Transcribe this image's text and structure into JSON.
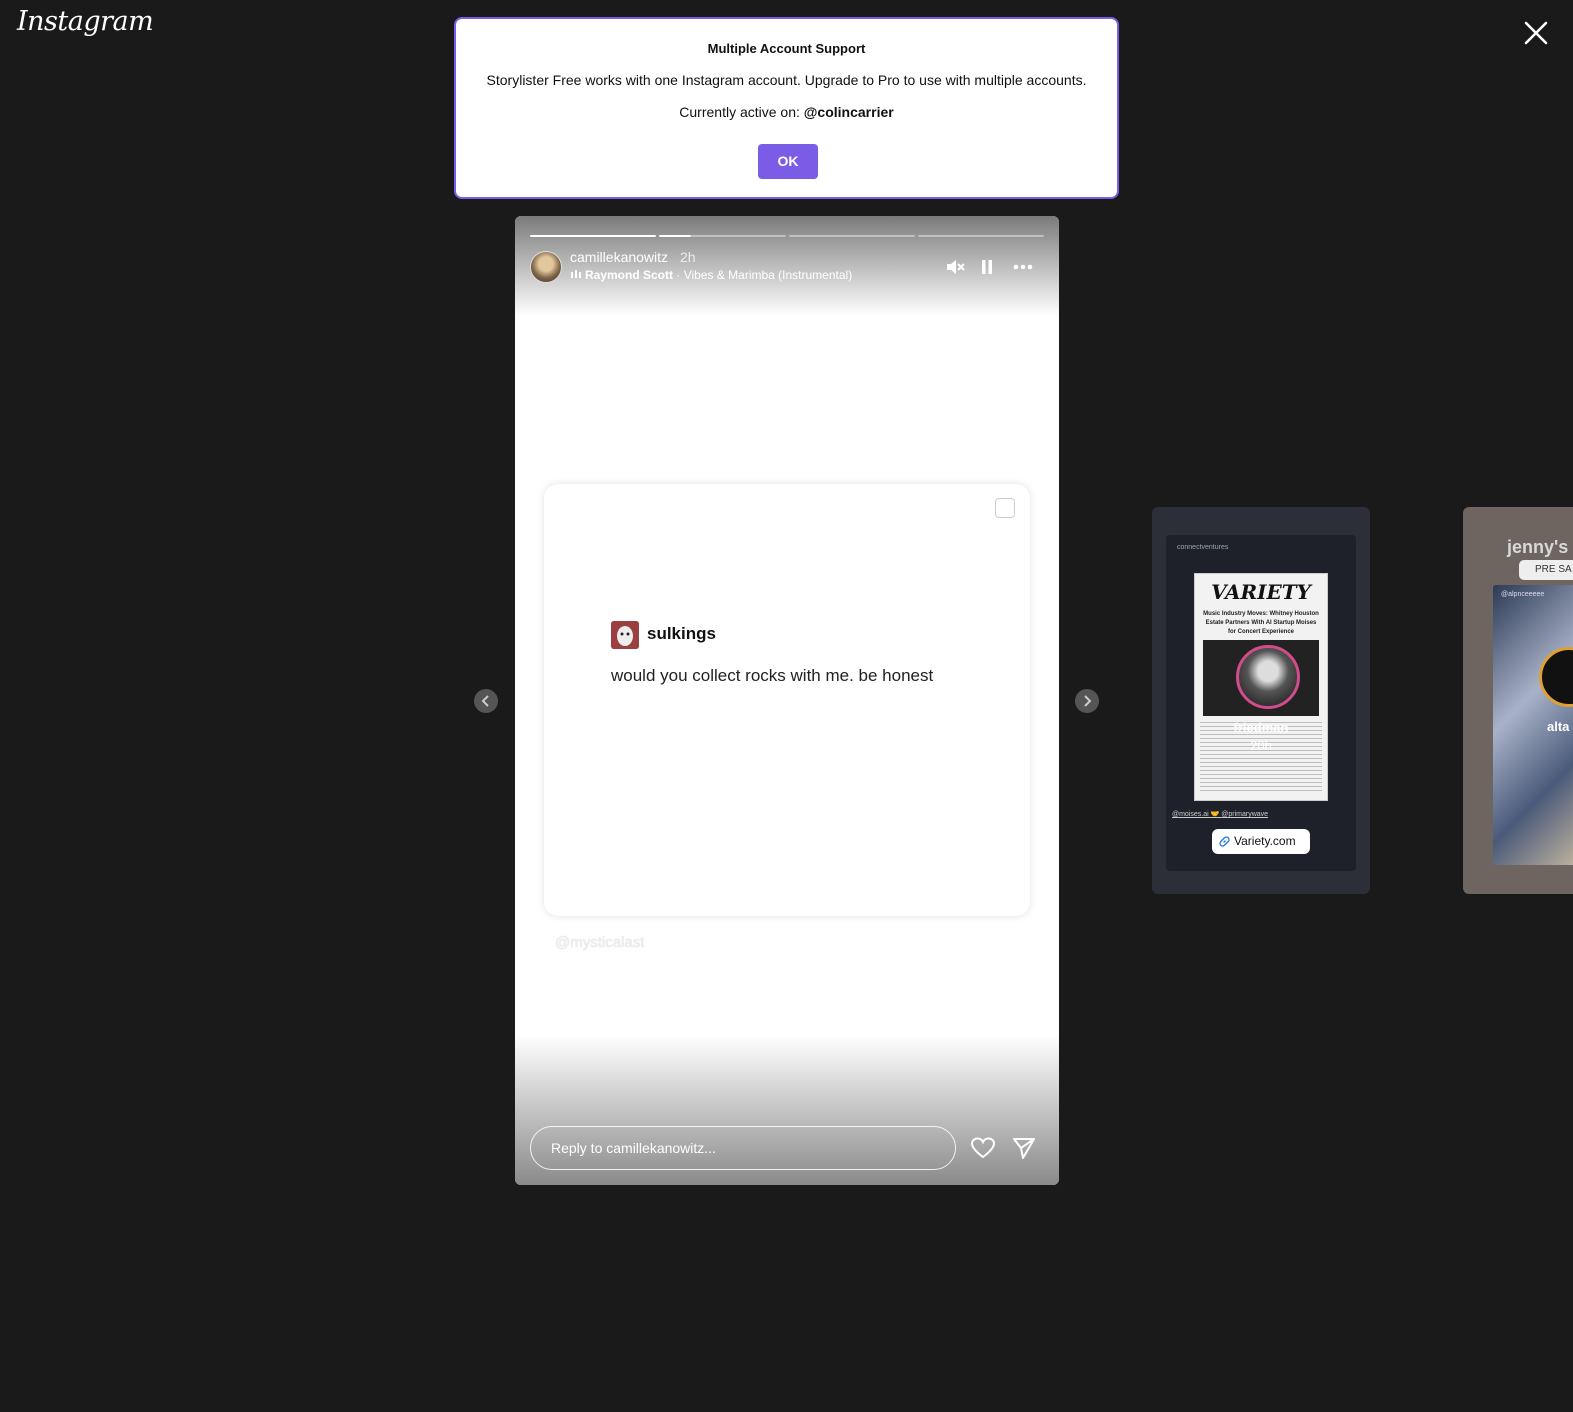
{
  "app": {
    "logo_text": "Instagram"
  },
  "modal": {
    "title": "Multiple Account Support",
    "message": "Storylister Free works with one Instagram account. Upgrade to Pro to use with multiple accounts.",
    "active_prefix": "Currently active on: ",
    "active_account": "@colincarrier",
    "ok_label": "OK",
    "accent_color": "#7b5ce6"
  },
  "story": {
    "username": "camillekanowitz",
    "time": "2h",
    "music_artist": "Raymond Scott",
    "music_separator": " · ",
    "music_track": "Vibes & Marimba (Instrumental)",
    "progress_segments": 4,
    "post": {
      "author": "sulkings",
      "text": "would you collect rocks with me. be honest"
    },
    "watermark": "@mysticalast",
    "reply_placeholder": "Reply to camillekanowitz...",
    "icons": [
      "mute-icon",
      "pause-icon",
      "more-icon",
      "heart-icon",
      "send-icon"
    ]
  },
  "preview_next": {
    "handle": "connectventures",
    "article_logo": "VARIETY",
    "article_headline": "Music Industry Moves: Whitney Houston Estate Partners With AI Startup Moises for Concert Experience",
    "username": "friedman",
    "time": "20h",
    "tags": "@moises.ai 🤝 @primarywave",
    "link_label": "Variety.com"
  },
  "preview_after": {
    "title": "jenny's",
    "tag_label": "PRE SA",
    "handle": "@alpnceeeee",
    "username": "alta"
  }
}
